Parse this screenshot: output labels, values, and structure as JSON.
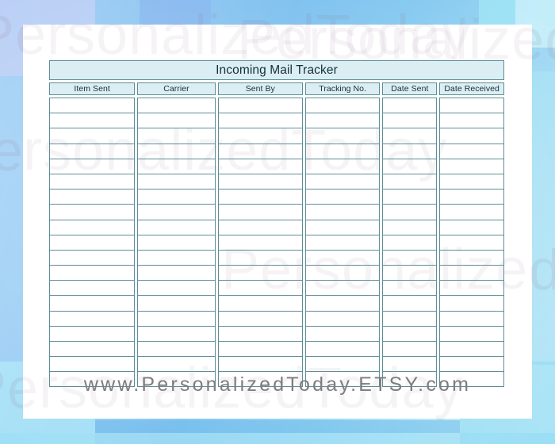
{
  "document": {
    "title": "Incoming Mail Tracker",
    "footer_url": "www.PersonalizedToday.ETSY.com",
    "watermark_text": "PersonalizedToday"
  },
  "table": {
    "columns": [
      {
        "label": "Item Sent"
      },
      {
        "label": "Carrier"
      },
      {
        "label": "Sent By"
      },
      {
        "label": "Tracking No."
      },
      {
        "label": "Date Sent"
      },
      {
        "label": "Date Received"
      }
    ],
    "row_count": 19,
    "rows": [
      [
        "",
        "",
        "",
        "",
        "",
        ""
      ],
      [
        "",
        "",
        "",
        "",
        "",
        ""
      ],
      [
        "",
        "",
        "",
        "",
        "",
        ""
      ],
      [
        "",
        "",
        "",
        "",
        "",
        ""
      ],
      [
        "",
        "",
        "",
        "",
        "",
        ""
      ],
      [
        "",
        "",
        "",
        "",
        "",
        ""
      ],
      [
        "",
        "",
        "",
        "",
        "",
        ""
      ],
      [
        "",
        "",
        "",
        "",
        "",
        ""
      ],
      [
        "",
        "",
        "",
        "",
        "",
        ""
      ],
      [
        "",
        "",
        "",
        "",
        "",
        ""
      ],
      [
        "",
        "",
        "",
        "",
        "",
        ""
      ],
      [
        "",
        "",
        "",
        "",
        "",
        ""
      ],
      [
        "",
        "",
        "",
        "",
        "",
        ""
      ],
      [
        "",
        "",
        "",
        "",
        "",
        ""
      ],
      [
        "",
        "",
        "",
        "",
        "",
        ""
      ],
      [
        "",
        "",
        "",
        "",
        "",
        ""
      ],
      [
        "",
        "",
        "",
        "",
        "",
        ""
      ],
      [
        "",
        "",
        "",
        "",
        "",
        ""
      ],
      [
        "",
        "",
        "",
        "",
        "",
        ""
      ]
    ]
  },
  "colors": {
    "header_fill": "#dbeef3",
    "border": "#5e8e96",
    "text": "#15303a",
    "footer_text": "#7d7d7d",
    "paper": "#ffffff",
    "background_blue": "#7fc2ef",
    "background_lavender": "#cfe0fa",
    "background_cyan": "#dff6fb"
  }
}
